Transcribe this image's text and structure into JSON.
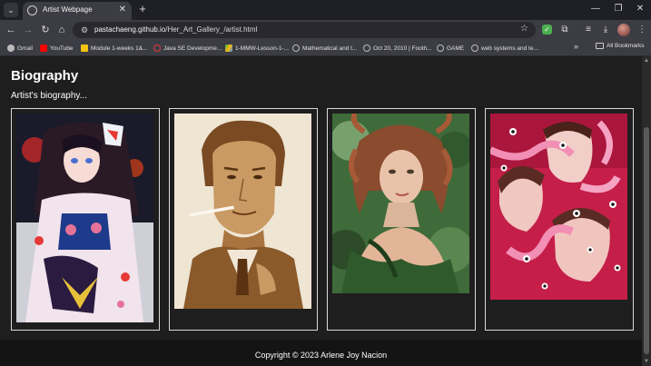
{
  "browser": {
    "tab_title": "Artist Webpage",
    "url_host": "pastachaeng.github.io",
    "url_path": "/Her_Art_Gallery_/artist.html",
    "bookmarks": [
      {
        "label": "Gmail",
        "icon": "gmail-icon",
        "color": "#bbbbbb"
      },
      {
        "label": "YouTube",
        "icon": "youtube-icon",
        "color": "#ff0000"
      },
      {
        "label": "Module 1-weeks 1&...",
        "icon": "module-icon",
        "color": "#f4c20d"
      },
      {
        "label": "Java SE Developme...",
        "icon": "java-icon",
        "color": "#e53935"
      },
      {
        "label": "1-MMW-Lesson-1-...",
        "icon": "drive-icon",
        "color": "#34a853"
      },
      {
        "label": "Mathematical and t...",
        "icon": "globe-icon",
        "color": "#bbbbbb"
      },
      {
        "label": "Oct 20, 2010 | Footh...",
        "icon": "globe-icon",
        "color": "#bbbbbb"
      },
      {
        "label": "GAME",
        "icon": "globe-icon",
        "color": "#bbbbbb"
      },
      {
        "label": "web systems and te...",
        "icon": "globe-icon",
        "color": "#bbbbbb"
      }
    ],
    "all_bookmarks": "All Bookmarks"
  },
  "page": {
    "bio_title": "Biography",
    "bio_text": "Artist's biography...",
    "artworks": [
      {
        "name": "artwork-kimono-girl",
        "alt": "Girl in kimono with fox mask"
      },
      {
        "name": "artwork-sepia-man",
        "alt": "Sepia portrait of man with cigarette"
      },
      {
        "name": "artwork-medusa",
        "alt": "Woman with serpent hair"
      },
      {
        "name": "artwork-surreal-faces",
        "alt": "Surreal faces with eyes and tentacles"
      }
    ],
    "footer": "Copyright © 2023 Arlene Joy Nacion"
  }
}
